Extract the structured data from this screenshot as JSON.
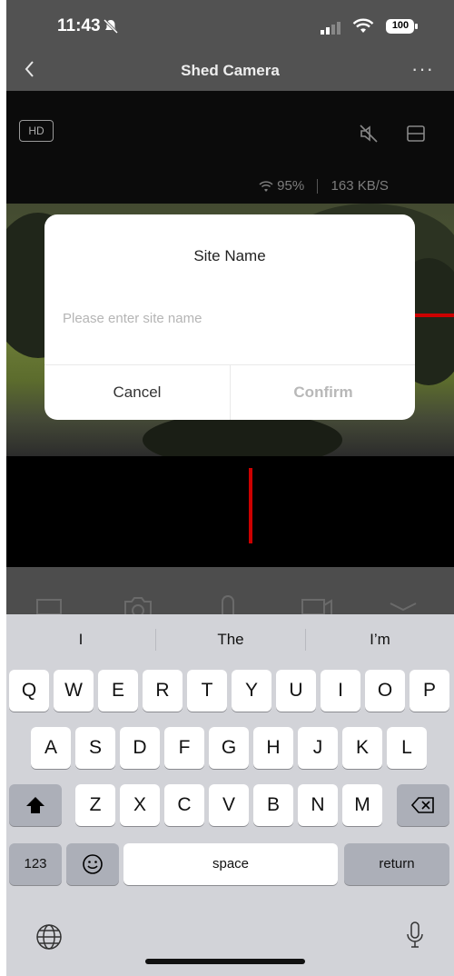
{
  "status": {
    "time": "11:43",
    "battery": "100"
  },
  "nav": {
    "title": "Shed Camera"
  },
  "video": {
    "hd_label": "HD",
    "wifi_percent": "95%",
    "bitrate": "163 KB/S"
  },
  "dialog": {
    "title": "Site Name",
    "input_placeholder": "Please enter site name",
    "input_value": "",
    "cancel_label": "Cancel",
    "confirm_label": "Confirm"
  },
  "keyboard": {
    "suggestions": [
      "I",
      "The",
      "I’m"
    ],
    "row1": [
      "Q",
      "W",
      "E",
      "R",
      "T",
      "Y",
      "U",
      "I",
      "O",
      "P"
    ],
    "row2": [
      "A",
      "S",
      "D",
      "F",
      "G",
      "H",
      "J",
      "K",
      "L"
    ],
    "row3": [
      "Z",
      "X",
      "C",
      "V",
      "B",
      "N",
      "M"
    ],
    "numbers_label": "123",
    "space_label": "space",
    "return_label": "return"
  }
}
